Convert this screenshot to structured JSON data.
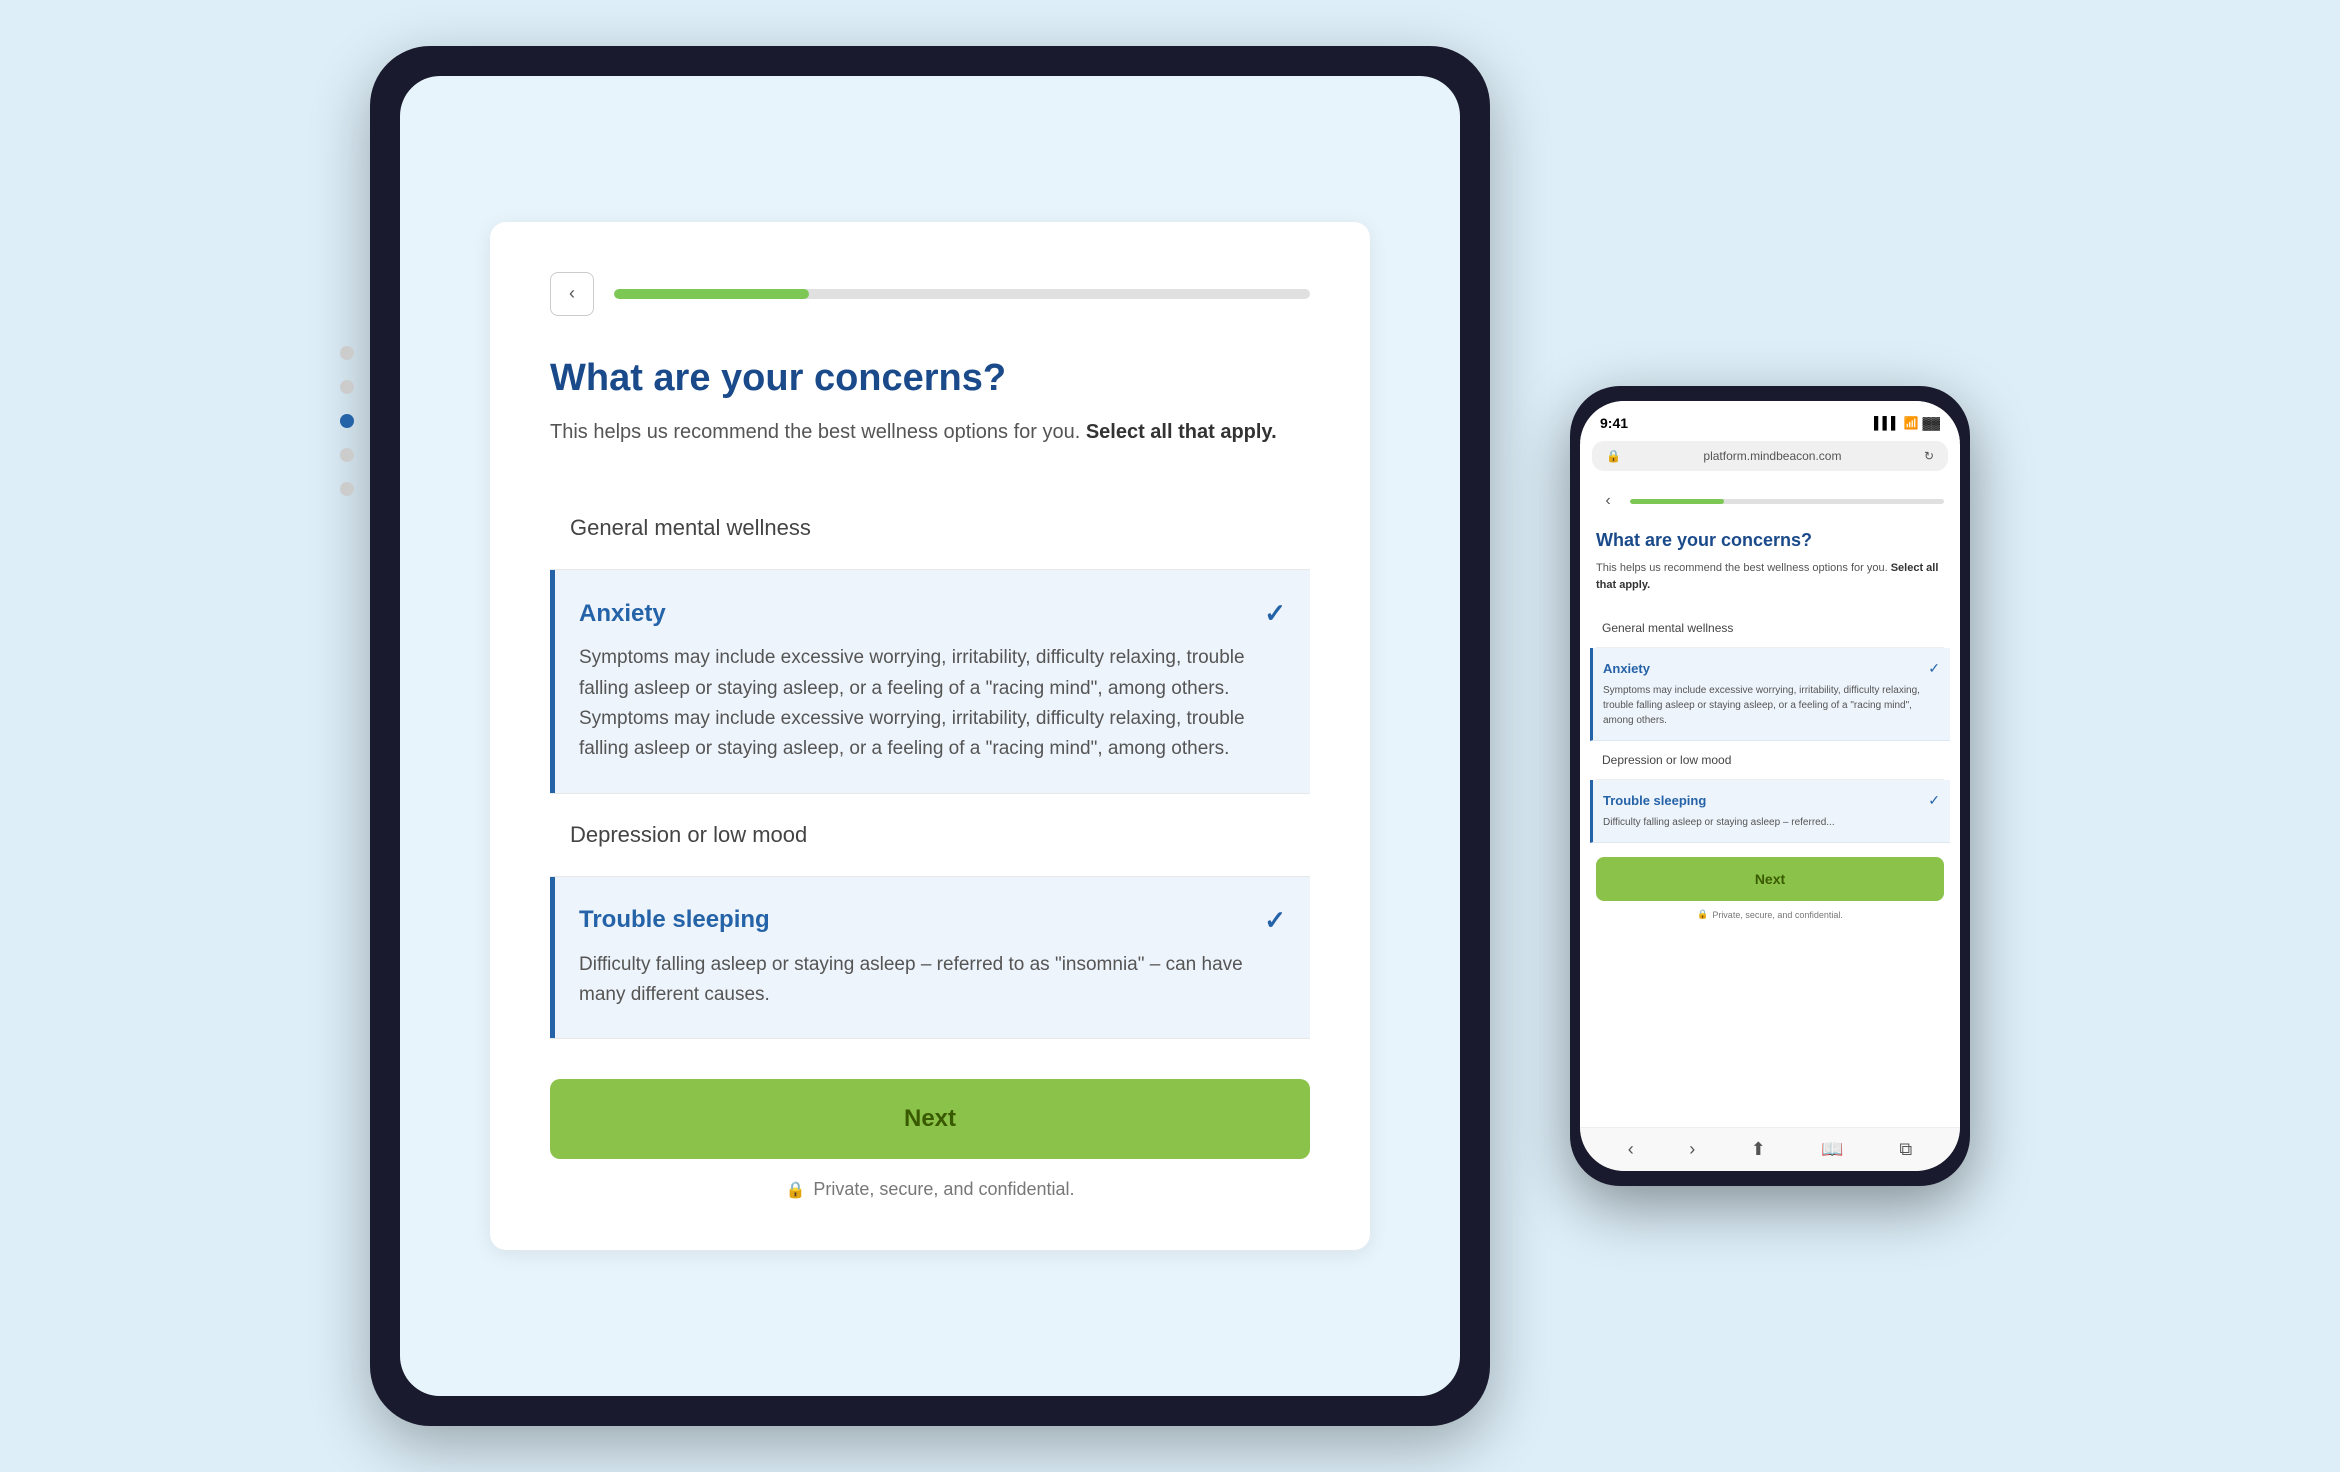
{
  "scene": {
    "background_color": "#ddeef8"
  },
  "tablet": {
    "progress": {
      "back_label": "‹",
      "fill_percent": 28
    },
    "page_title": "What are your concerns?",
    "page_subtitle": "This helps us recommend the best wellness options for you.",
    "page_subtitle_bold": "Select all that apply.",
    "options": [
      {
        "id": "general-mental-wellness",
        "label": "General mental wellness",
        "selected": false,
        "expanded": false
      },
      {
        "id": "anxiety",
        "label": "Anxiety",
        "selected": true,
        "expanded": true,
        "description": "Symptoms may include excessive worrying, irritability, difficulty relaxing, trouble falling asleep or staying asleep, or a feeling of a \"racing mind\", among others. Symptoms may include excessive worrying, irritability, difficulty relaxing, trouble falling asleep or staying asleep, or a feeling of a \"racing mind\", among others."
      },
      {
        "id": "depression",
        "label": "Depression or low mood",
        "selected": false,
        "expanded": false
      },
      {
        "id": "trouble-sleeping",
        "label": "Trouble sleeping",
        "selected": true,
        "expanded": true,
        "description": "Difficulty falling asleep or staying asleep – referred to as \"insomnia\" – can have many different causes."
      }
    ],
    "next_button_label": "Next",
    "privacy_text": "Private, secure, and confidential."
  },
  "phone": {
    "status_bar": {
      "time": "9:41",
      "url": "platform.mindbeacon.com"
    },
    "progress": {
      "back_label": "‹",
      "fill_percent": 30
    },
    "page_title": "What are your concerns?",
    "page_subtitle": "This helps us recommend the best wellness options for you.",
    "page_subtitle_bold": "Select all that apply.",
    "options": [
      {
        "id": "general-mental-wellness",
        "label": "General mental wellness",
        "selected": false,
        "expanded": false
      },
      {
        "id": "anxiety",
        "label": "Anxiety",
        "selected": true,
        "expanded": true,
        "description": "Symptoms may include excessive worrying, irritability, difficulty relaxing, trouble falling asleep or staying asleep, or a feeling of a \"racing mind\", among others."
      },
      {
        "id": "depression",
        "label": "Depression or low mood",
        "selected": false,
        "expanded": false
      },
      {
        "id": "trouble-sleeping",
        "label": "Trouble sleeping",
        "selected": true,
        "expanded": true,
        "description": "Difficulty falling asleep or staying asleep – referred..."
      }
    ],
    "next_button_label": "Next",
    "privacy_text": "Private, secure, and confidential.",
    "bottom_icons": [
      "‹",
      "›",
      "⬆",
      "📖",
      "⧉"
    ]
  }
}
